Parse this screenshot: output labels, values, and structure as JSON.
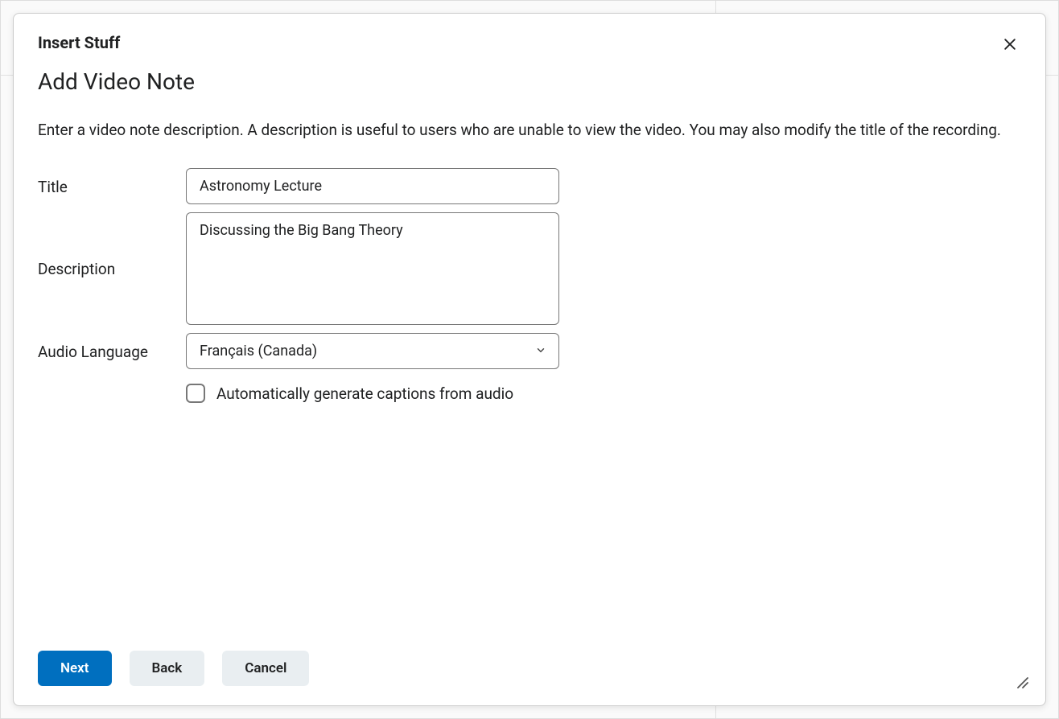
{
  "modal": {
    "title": "Insert Stuff",
    "subtitle": "Add Video Note",
    "instruction": "Enter a video note description. A description is useful to users who are unable to view the video. You may also modify the title of the recording."
  },
  "form": {
    "title_label": "Title",
    "title_value": "Astronomy Lecture",
    "description_label": "Description",
    "description_value": "Discussing the Big Bang Theory",
    "audio_language_label": "Audio Language",
    "audio_language_value": "Français (Canada)",
    "captions_checkbox_label": "Automatically generate captions from audio"
  },
  "footer": {
    "next_label": "Next",
    "back_label": "Back",
    "cancel_label": "Cancel"
  }
}
